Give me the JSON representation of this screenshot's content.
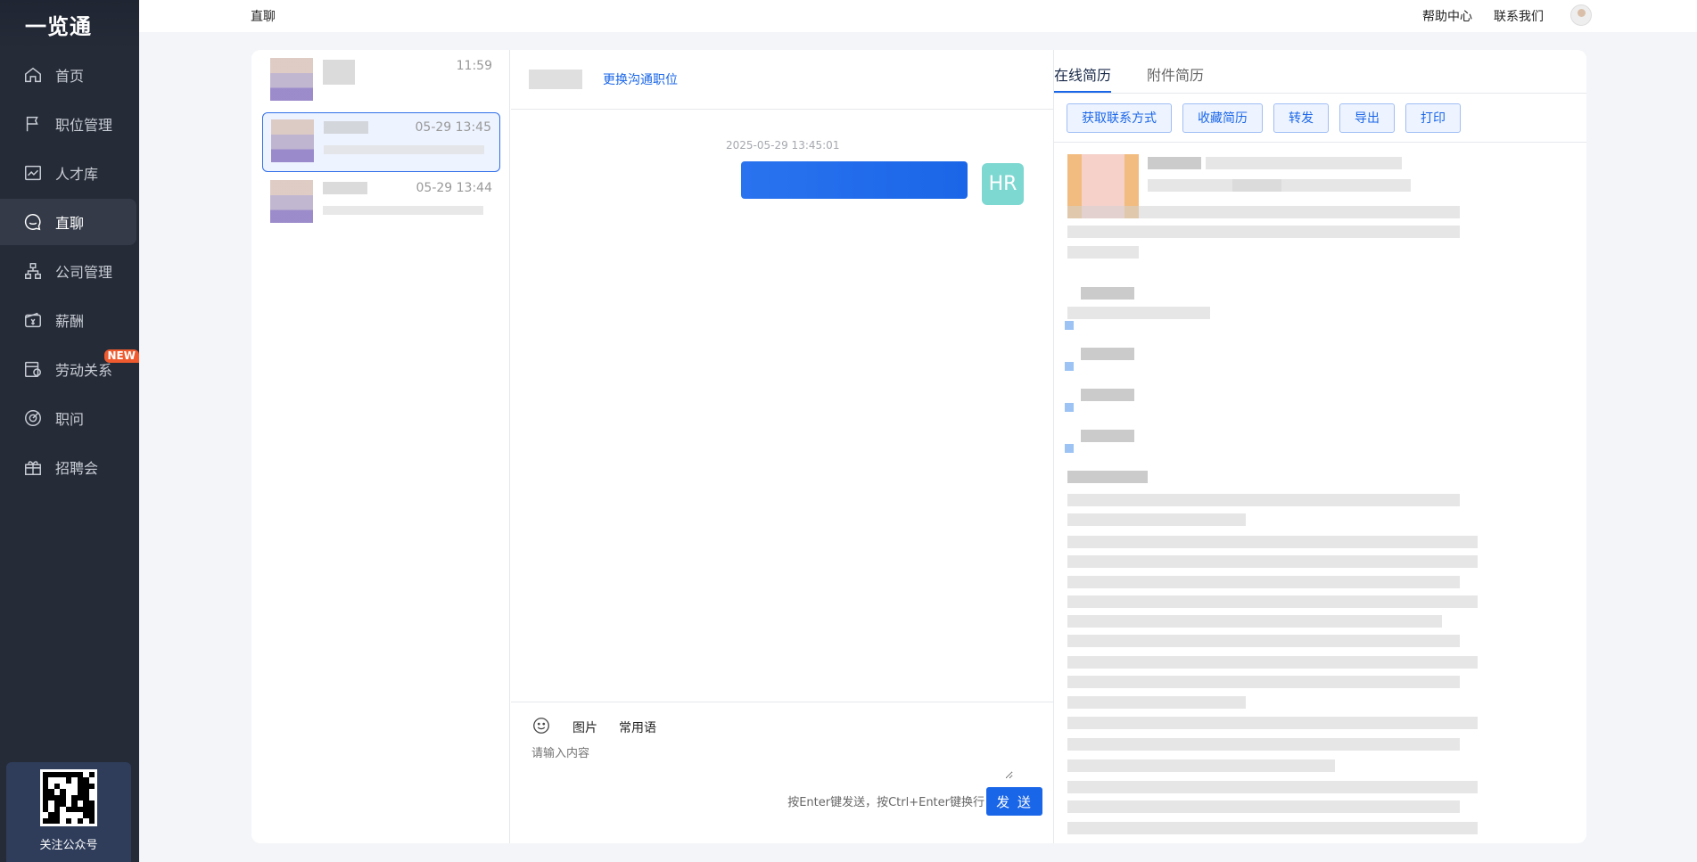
{
  "app": {
    "logo": "一览通"
  },
  "sidebar": {
    "items": [
      {
        "label": "首页",
        "icon": "home-icon"
      },
      {
        "label": "职位管理",
        "icon": "flag-icon"
      },
      {
        "label": "人才库",
        "icon": "chart-icon"
      },
      {
        "label": "直聊",
        "icon": "chat-icon",
        "active": true
      },
      {
        "label": "公司管理",
        "icon": "org-icon"
      },
      {
        "label": "薪酬",
        "icon": "wallet-icon"
      },
      {
        "label": "劳动关系",
        "icon": "contract-icon",
        "badge": "NEW"
      },
      {
        "label": "职问",
        "icon": "target-icon"
      },
      {
        "label": "招聘会",
        "icon": "gift-icon"
      }
    ],
    "follow_label": "关注公众号"
  },
  "topbar": {
    "title": "直聊",
    "help": "帮助中心",
    "contact": "联系我们"
  },
  "conversations": [
    {
      "time": "11:59"
    },
    {
      "time": "05-29 13:45",
      "active": true
    },
    {
      "time": "05-29 13:44"
    }
  ],
  "chat": {
    "switch_position": "更换沟通职位",
    "message_time": "2025-05-29 13:45:01",
    "hr_avatar": "HR",
    "toolbar": {
      "image": "图片",
      "phrases": "常用语"
    },
    "input_placeholder": "请输入内容",
    "hint": "按Enter键发送，按Ctrl+Enter键换行",
    "send": "发 送"
  },
  "resume": {
    "tabs": [
      "在线简历",
      "附件简历"
    ],
    "actions": [
      "获取联系方式",
      "收藏简历",
      "转发",
      "导出",
      "打印"
    ]
  },
  "colors": {
    "sidebar": "#252b37",
    "accent": "#1a66e8",
    "badge": "#ef5a2e",
    "hr_avatar": "#7dd8d1"
  }
}
